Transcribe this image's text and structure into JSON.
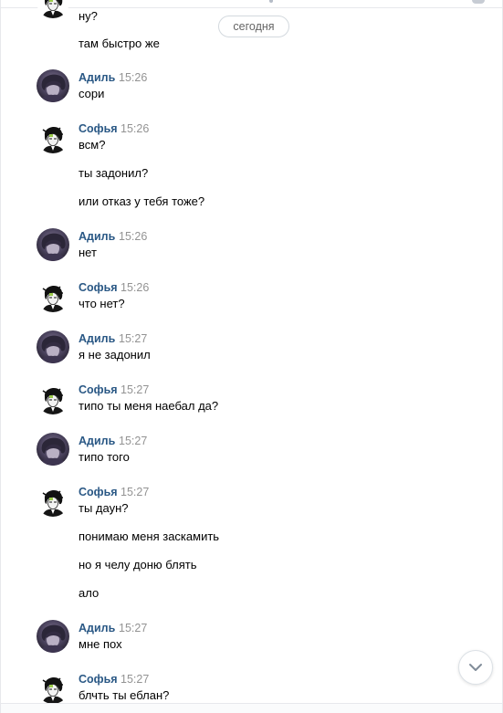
{
  "date_divider": "сегодня",
  "users": {
    "adil": "Адиль",
    "sofya": "Софья"
  },
  "top": {
    "m1": "ну?",
    "m2": "там быстро же"
  },
  "groups": [
    {
      "author": "Адиль",
      "time": "15:26",
      "messages": [
        "сори"
      ]
    },
    {
      "author": "Софья",
      "time": "15:26",
      "messages": [
        "всм?",
        "ты задонил?",
        "или отказ у тебя тоже?"
      ]
    },
    {
      "author": "Адиль",
      "time": "15:26",
      "messages": [
        "нет"
      ]
    },
    {
      "author": "Софья",
      "time": "15:26",
      "messages": [
        "что нет?"
      ]
    },
    {
      "author": "Адиль",
      "time": "15:27",
      "messages": [
        "я не задонил"
      ]
    },
    {
      "author": "Софья",
      "time": "15:27",
      "messages": [
        "типо ты меня наебал да?"
      ]
    },
    {
      "author": "Адиль",
      "time": "15:27",
      "messages": [
        "типо того"
      ]
    },
    {
      "author": "Софья",
      "time": "15:27",
      "messages": [
        "ты даун?",
        "понимаю меня заскамить",
        "но я челу доню блять",
        "ало"
      ]
    },
    {
      "author": "Адиль",
      "time": "15:27",
      "messages": [
        "мне пох"
      ]
    },
    {
      "author": "Софья",
      "time": "15:27",
      "messages": [
        "блчть ты еблан?"
      ]
    }
  ],
  "icons": {
    "avatar_adil": "avatar-adil-icon",
    "avatar_sofya": "avatar-sofya-icon",
    "scroll_down": "chevron-down-icon"
  },
  "colors": {
    "author_link": "#2a5885",
    "time_text": "#939393",
    "message_text": "#000000",
    "divider_border": "#d3d9de"
  }
}
